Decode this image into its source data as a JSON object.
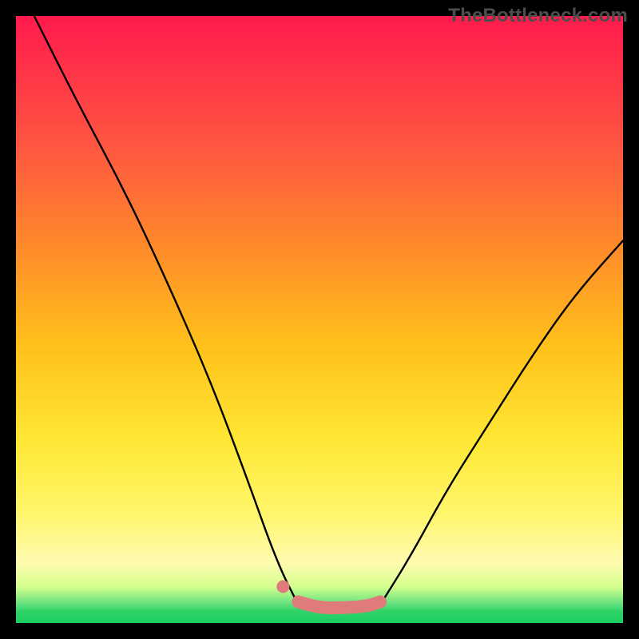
{
  "watermark": "TheBottleneck.com",
  "chart_data": {
    "type": "line",
    "title": "",
    "xlabel": "",
    "ylabel": "",
    "xlim": [
      0,
      100
    ],
    "ylim": [
      0,
      100
    ],
    "background_gradient_vertical_percent": {
      "0": "crimson",
      "50": "orange",
      "75": "yellow",
      "95": "pale-yellow",
      "100": "green"
    },
    "series": [
      {
        "name": "left-branch",
        "x": [
          3,
          10,
          18,
          25,
          32,
          38,
          43,
          46.5
        ],
        "values": [
          100,
          86,
          71,
          56,
          40,
          24,
          10,
          3
        ]
      },
      {
        "name": "right-branch",
        "x": [
          60,
          65,
          71,
          78,
          85,
          92,
          100
        ],
        "values": [
          3,
          11,
          22,
          33,
          44,
          54,
          63
        ]
      },
      {
        "name": "bottom-flat-highlight",
        "x": [
          46.5,
          50,
          54,
          58,
          60
        ],
        "values": [
          3.5,
          2.5,
          2.5,
          2.8,
          3.5
        ]
      }
    ],
    "annotations": [
      {
        "name": "link-dot-left",
        "x": 44,
        "y": 6
      }
    ]
  }
}
